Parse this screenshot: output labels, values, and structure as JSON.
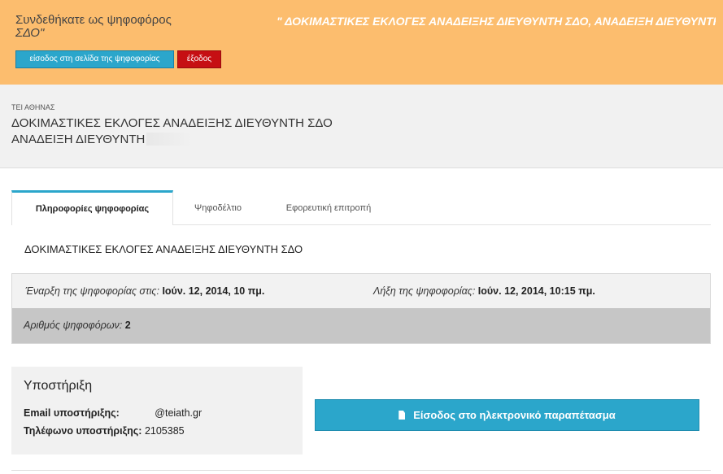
{
  "banner": {
    "voter_msg": "Συνδεθήκατε ως ψηφοφόρος",
    "voter_msg_suffix": "ΣΔΟ\"",
    "election_title": "\" ΔΟΚΙΜΑΣΤΙΚΕΣ ΕΚΛΟΓΕΣ ΑΝΑΔΕΙΞΗΣ ΔΙΕΥΘΥΝΤΗ ΣΔΟ, ΑΝΑΔΕΙΞΗ ΔΙΕΥΘΥΝΤΗ",
    "enter_button": "είσοδος στη σελίδα της ψηφοφορίας",
    "exit_button": "έξοδος"
  },
  "header": {
    "institution": "ΤΕΙ ΑΘΗΝΑΣ",
    "title_line1": "ΔΟΚΙΜΑΣΤΙΚΕΣ ΕΚΛΟΓΕΣ ΑΝΑΔΕΙΞΗΣ ΔΙΕΥΘΥΝΤΗ ΣΔΟ",
    "title_line2": "ΑΝΑΔΕΙΞΗ ΔΙΕΥΘΥΝΤΗ"
  },
  "tabs": [
    {
      "label": "Πληροφορίες ψηφοφορίας",
      "active": true
    },
    {
      "label": "Ψηφοδέλτιο",
      "active": false
    },
    {
      "label": "Εφορευτική επιτροπή",
      "active": false
    }
  ],
  "info": {
    "description": "ΔΟΚΙΜΑΣΤΙΚΕΣ ΕΚΛΟΓΕΣ ΑΝΑΔΕΙΞΗΣ ΔΙΕΥΘΥΝΤΗ ΣΔΟ",
    "start_label": "Έναρξη της ψηφοφορίας στις:",
    "start_value": "Ιούν. 12, 2014, 10 πμ.",
    "end_label": "Λήξη της ψηφοφορίας:",
    "end_value": "Ιούν. 12, 2014, 10:15 πμ.",
    "voters_label": "Αριθμός ψηφοφόρων:",
    "voters_value": "2"
  },
  "support": {
    "heading": "Υποστήριξη",
    "email_label": "Email υποστήριξης:",
    "email_value": "@teiath.gr",
    "phone_label": "Τηλέφωνο υποστήριξης:",
    "phone_value": "2105385"
  },
  "ballot_button": "Είσοδος στο ηλεκτρονικό παραπέτασμα",
  "colors": {
    "banner_bg": "#fcbd6e",
    "primary_blue": "#2ba6cb",
    "danger_red": "#c60f13"
  }
}
